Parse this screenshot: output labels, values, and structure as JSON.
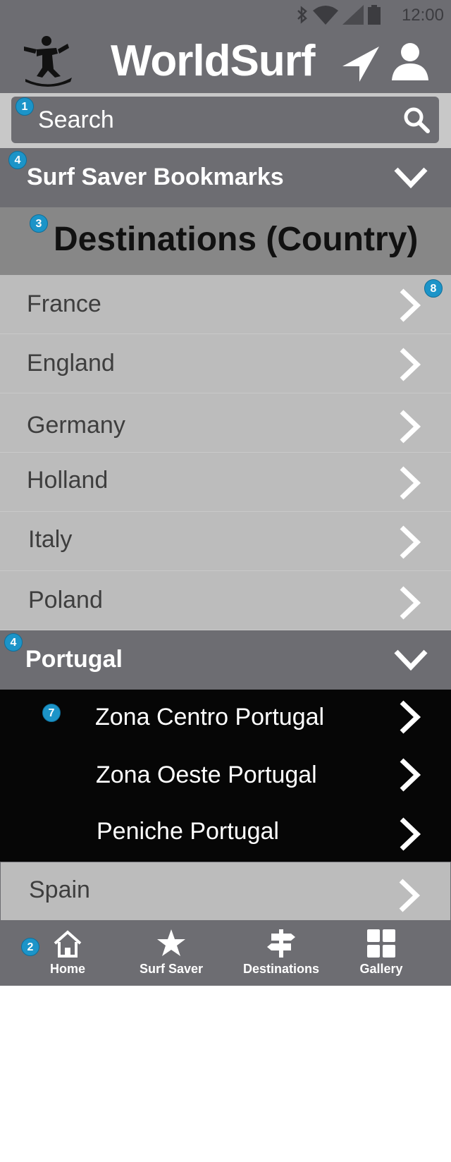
{
  "status_bar": {
    "time": "12:00"
  },
  "app": {
    "title": "WorldSurf"
  },
  "search": {
    "placeholder": "Search"
  },
  "bookmarks": {
    "label": "Surf Saver Bookmarks"
  },
  "destinations": {
    "header": "Destinations (Country)",
    "countries_before": [
      {
        "name": "France"
      },
      {
        "name": "England"
      },
      {
        "name": "Germany"
      },
      {
        "name": "Holland"
      },
      {
        "name": "Italy"
      },
      {
        "name": "Poland"
      }
    ],
    "expanded": {
      "name": "Portugal",
      "regions": [
        {
          "name": "Zona Centro Portugal"
        },
        {
          "name": "Zona Oeste Portugal"
        },
        {
          "name": "Peniche Portugal"
        }
      ]
    },
    "countries_after": [
      {
        "name": "Spain"
      }
    ]
  },
  "annotations": [
    "1",
    "2",
    "3",
    "4",
    "4",
    "7",
    "8"
  ],
  "bottom_nav": {
    "items": [
      {
        "label": "Home",
        "icon": "home-icon"
      },
      {
        "label": "Surf Saver",
        "icon": "star-icon"
      },
      {
        "label": "Destinations",
        "icon": "signpost-icon"
      },
      {
        "label": "Gallery",
        "icon": "grid-icon"
      }
    ]
  },
  "colors": {
    "bar_gray": "#6d6d72",
    "country_row": "#bcbcbc",
    "header_gray": "#878787",
    "expanded_bg": "#060606",
    "badge_blue": "#1c94c8"
  }
}
